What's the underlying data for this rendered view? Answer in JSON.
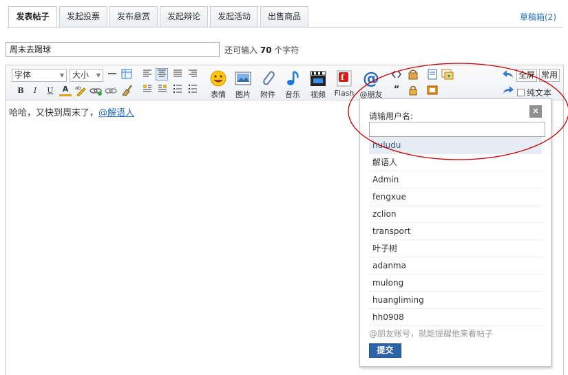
{
  "tabs": [
    {
      "label": "发表帖子",
      "active": true
    },
    {
      "label": "发起投票"
    },
    {
      "label": "发布悬赏"
    },
    {
      "label": "发起辩论"
    },
    {
      "label": "发起活动"
    },
    {
      "label": "出售商品"
    }
  ],
  "drafts_label": "草稿箱(2)",
  "subject": {
    "value": "周末去踢球",
    "remaining_prefix": "还可输入",
    "remaining_count": "70",
    "remaining_suffix": "个字符"
  },
  "toolbar": {
    "font_select": "字体",
    "size_select": "大小",
    "bold": "B",
    "italic": "I",
    "underline": "U",
    "font_color": "A",
    "big_buttons": [
      "表情",
      "图片",
      "附件",
      "音乐",
      "视频",
      "Flash",
      "@朋友"
    ],
    "fullscreen": "全屏",
    "common": "常用",
    "plain_text": "纯文本"
  },
  "editor": {
    "text": "哈哈，又快到周末了，",
    "mention": "@解语人"
  },
  "mention_popup": {
    "title": "请输用户名:",
    "input_value": "",
    "users": [
      "huludu",
      "解语人",
      "Admin",
      "fengxue",
      "zclion",
      "transport",
      "叶子树",
      "adanma",
      "mulong",
      "huangliming",
      "hh0908"
    ],
    "highlighted_index": 0,
    "hint": "@朋友账号，就能提醒他来看帖子",
    "submit": "提交",
    "close": "×"
  },
  "colors": {
    "link": "#2a6fbd",
    "submit_bg": "#2d64a8",
    "annotation": "#c40000"
  }
}
